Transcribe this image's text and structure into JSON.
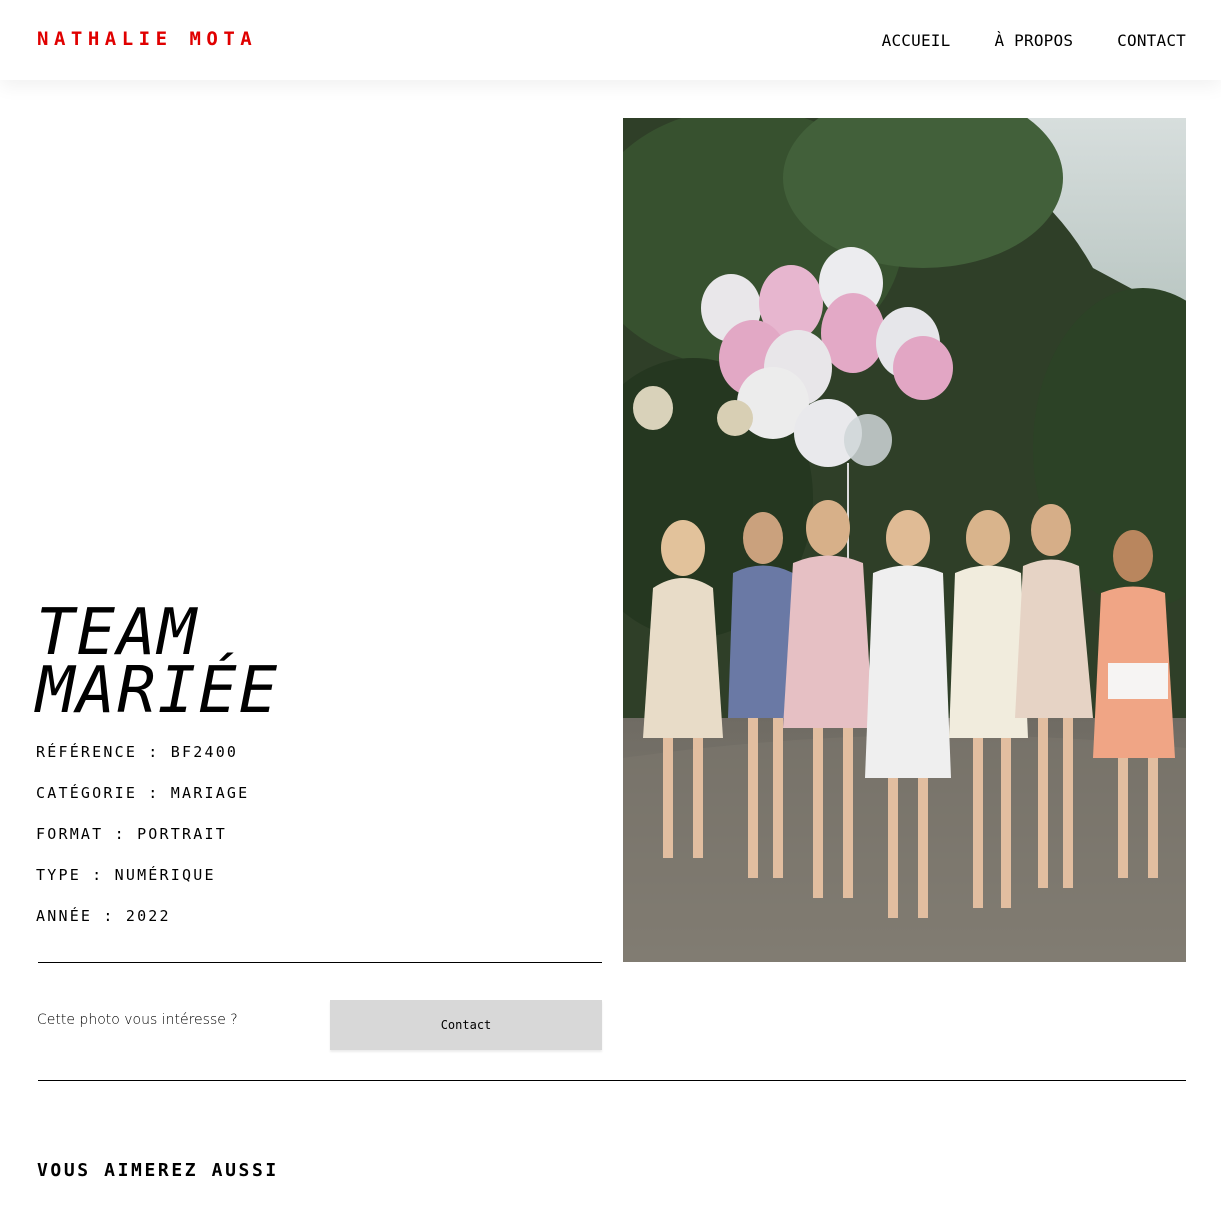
{
  "header": {
    "logo": "NATHALIE MOTA",
    "nav": [
      {
        "label": "ACCUEIL"
      },
      {
        "label": "À PROPOS"
      },
      {
        "label": "CONTACT"
      }
    ]
  },
  "photo": {
    "title": {
      "line1": "TEAM",
      "line2": "MARIÉE"
    },
    "details": [
      {
        "text": "RÉFÉRENCE : BF2400"
      },
      {
        "text": "CATÉGORIE : MARIAGE"
      },
      {
        "text": "FORMAT : PORTRAIT"
      },
      {
        "text": "TYPE : NUMÉRIQUE"
      },
      {
        "text": "ANNÉE : 2022"
      }
    ]
  },
  "contact_section": {
    "prompt": "Cette photo vous intéresse ?",
    "button_label": "Contact"
  },
  "related": {
    "heading": "VOUS AIMEREZ AUSSI"
  },
  "colors": {
    "accent": "#e00000",
    "button_bg": "#d8d8d8"
  }
}
